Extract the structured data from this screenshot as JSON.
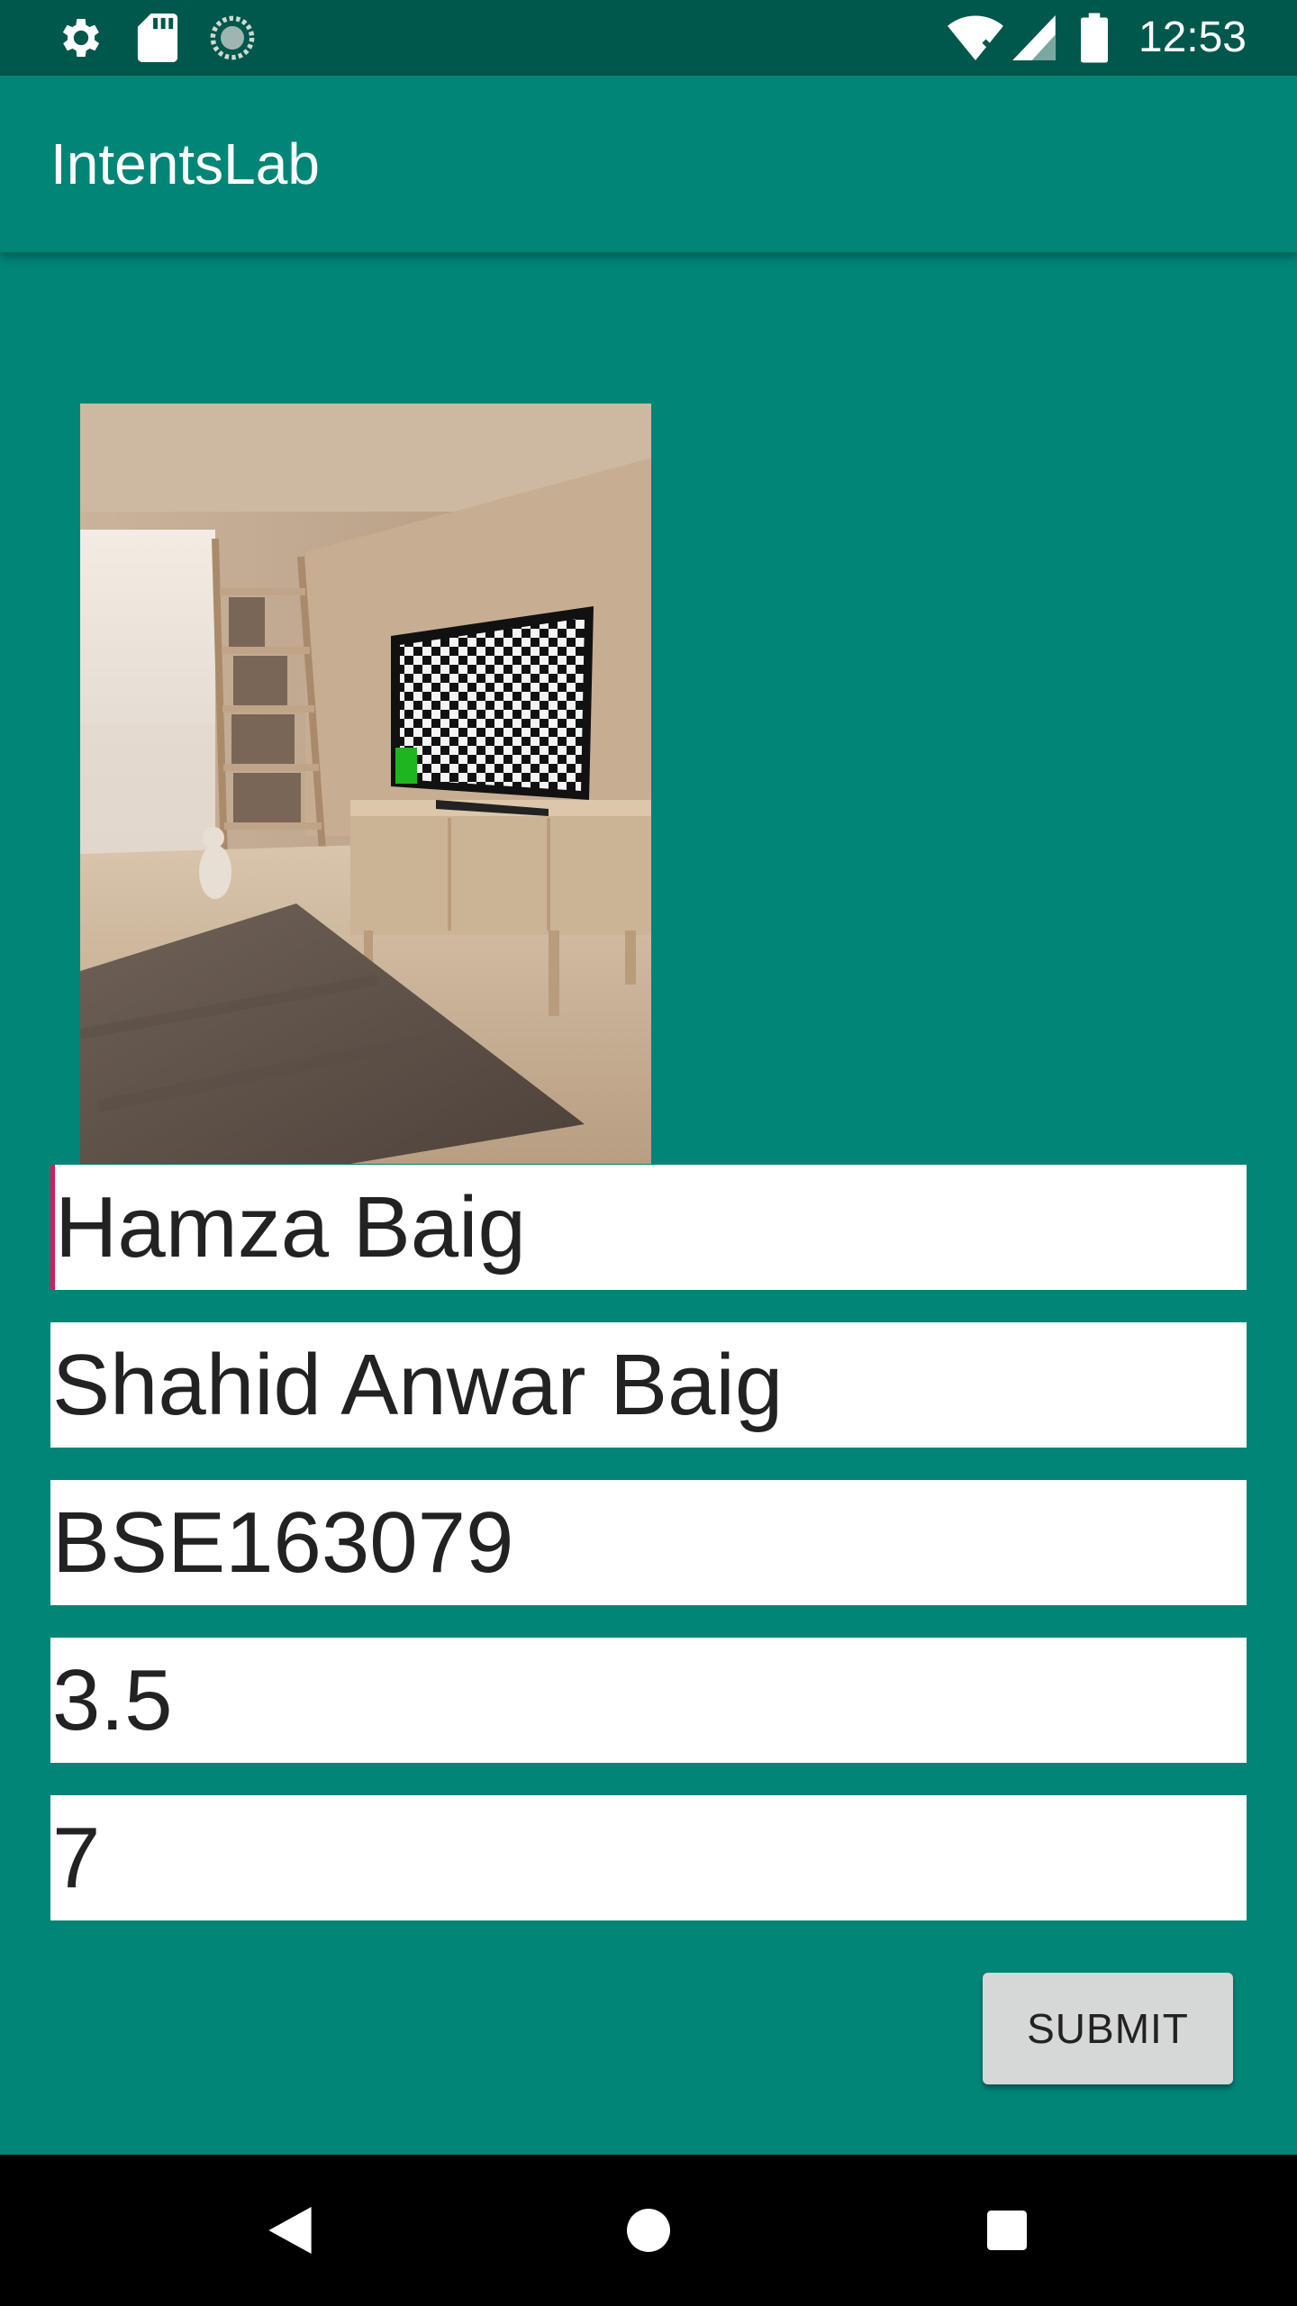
{
  "status_bar": {
    "time": "12:53",
    "left_icons": [
      "gear-icon",
      "sd-card-icon",
      "sync-icon"
    ],
    "right_icons": [
      "wifi-off-icon",
      "signal-icon",
      "battery-icon"
    ]
  },
  "app_bar": {
    "title": "IntentsLab"
  },
  "image": {
    "alt": "room-with-tv-photo"
  },
  "form": {
    "fields": [
      {
        "value": "Hamza Baig",
        "focused": true
      },
      {
        "value": "Shahid Anwar Baig",
        "focused": false
      },
      {
        "value": "BSE163079",
        "focused": false
      },
      {
        "value": "3.5",
        "focused": false
      },
      {
        "value": "7",
        "focused": false
      }
    ],
    "submit_label": "SUBMIT"
  },
  "nav_bar": {
    "buttons": [
      "back-icon",
      "home-icon",
      "recents-icon"
    ]
  },
  "colors": {
    "primary": "#008577",
    "primary_dark": "#00574B",
    "accent": "#D81B60"
  }
}
